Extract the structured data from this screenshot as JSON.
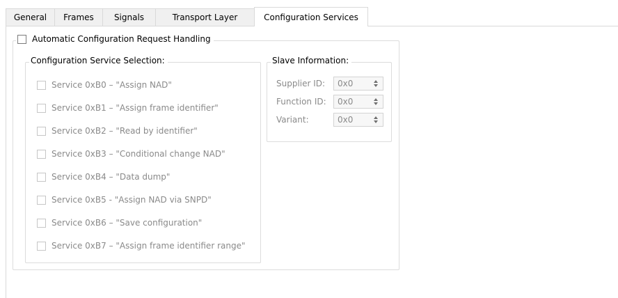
{
  "tabs": [
    {
      "label": "General"
    },
    {
      "label": "Frames"
    },
    {
      "label": "Signals"
    },
    {
      "label": "Transport Layer"
    },
    {
      "label": "Configuration Services"
    }
  ],
  "active_tab": "Configuration Services",
  "automatic": {
    "label": "Automatic Configuration Request Handling",
    "checked": false
  },
  "service_selection": {
    "title": "Configuration Service Selection:",
    "services": [
      {
        "label": "Service 0xB0 – \"Assign NAD\"",
        "checked": false,
        "enabled": false
      },
      {
        "label": "Service 0xB1 – \"Assign frame identifier\"",
        "checked": false,
        "enabled": false
      },
      {
        "label": "Service 0xB2 – \"Read by identifier\"",
        "checked": false,
        "enabled": false
      },
      {
        "label": "Service 0xB3 – \"Conditional change NAD\"",
        "checked": false,
        "enabled": false
      },
      {
        "label": "Service 0xB4 – \"Data dump\"",
        "checked": false,
        "enabled": false
      },
      {
        "label": "Service 0xB5 - \"Assign NAD via SNPD\"",
        "checked": false,
        "enabled": false
      },
      {
        "label": "Service 0xB6 – \"Save configuration\"",
        "checked": false,
        "enabled": false
      },
      {
        "label": "Service 0xB7 – \"Assign frame identifier range\"",
        "checked": false,
        "enabled": false
      }
    ]
  },
  "slave_info": {
    "title": "Slave Information:",
    "fields": [
      {
        "label": "Supplier ID:",
        "value": "0x0"
      },
      {
        "label": "Function ID:",
        "value": "0x0"
      },
      {
        "label": "Variant:",
        "value": "0x0"
      }
    ]
  },
  "colors": {
    "border": "#d9d9d9",
    "disabled_text": "#8a8a8a",
    "tab_inactive_bg": "#f0f0f0"
  }
}
